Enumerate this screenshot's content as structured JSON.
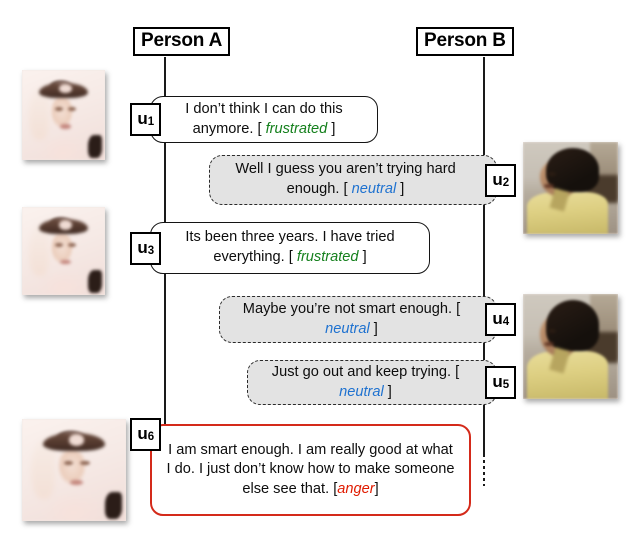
{
  "diagram": {
    "title_note": "dialogue emotion annotation timeline",
    "participants": [
      {
        "id": "person-a",
        "label": "Person A"
      },
      {
        "id": "person-b",
        "label": "Person B"
      }
    ],
    "emotion_colors": {
      "frustrated": "#15801d",
      "neutral": "#1f72d0",
      "anger": "#e01b00"
    },
    "bubble_colors": {
      "person_a_border": "#141414",
      "person_a_fill": "#ffffff",
      "person_b_border": "#2b2b2b",
      "person_b_fill": "#e3e3e3",
      "highlight_border": "#d42a1a"
    },
    "utterances": [
      {
        "tag": "u",
        "index": "1",
        "speaker": "Person A",
        "text_before": "I don’t think I can do this anymore. [ ",
        "emotion": "frustrated",
        "text_after": " ]",
        "full_text": "I don’t think I can do this anymore. [ frustrated ]"
      },
      {
        "tag": "u",
        "index": "2",
        "speaker": "Person B",
        "text_before": "Well I guess you aren’t trying hard enough. [ ",
        "emotion": "neutral",
        "text_after": " ]",
        "full_text": "Well I guess you aren’t trying hard enough. [ neutral ]"
      },
      {
        "tag": "u",
        "index": "3",
        "speaker": "Person A",
        "text_before": "Its been three years. I have tried everything. [ ",
        "emotion": "frustrated",
        "text_after": " ]",
        "full_text": "Its been three years. I have tried everything. [ frustrated ]"
      },
      {
        "tag": "u",
        "index": "4",
        "speaker": "Person B",
        "text_before": "Maybe you’re not smart enough. [ ",
        "emotion": "neutral",
        "text_after": " ]",
        "full_text": "Maybe you’re not smart enough. [ neutral ]"
      },
      {
        "tag": "u",
        "index": "5",
        "speaker": "Person B",
        "text_before": "Just go out and keep trying. [ ",
        "emotion": "neutral",
        "text_after": " ]",
        "full_text": "Just go out and keep trying. [ neutral ]"
      },
      {
        "tag": "u",
        "index": "6",
        "speaker": "Person A",
        "text_before": "I am smart enough. I am really good at what I do. I just don’t know how to make someone else see that. [",
        "emotion": "anger",
        "text_after": "]",
        "full_text": "I am smart enough. I am really good at what I do. I just don’t know how to make someone else see that. [anger]"
      }
    ],
    "thumbnails": [
      {
        "name": "person-a-frame-1",
        "subject": "woman with headband"
      },
      {
        "name": "person-b-frame-1",
        "subject": "man in yellow shirt"
      },
      {
        "name": "person-a-frame-2",
        "subject": "woman with headband"
      },
      {
        "name": "person-b-frame-2",
        "subject": "man in yellow shirt"
      },
      {
        "name": "person-a-frame-3",
        "subject": "woman with headband"
      }
    ]
  }
}
